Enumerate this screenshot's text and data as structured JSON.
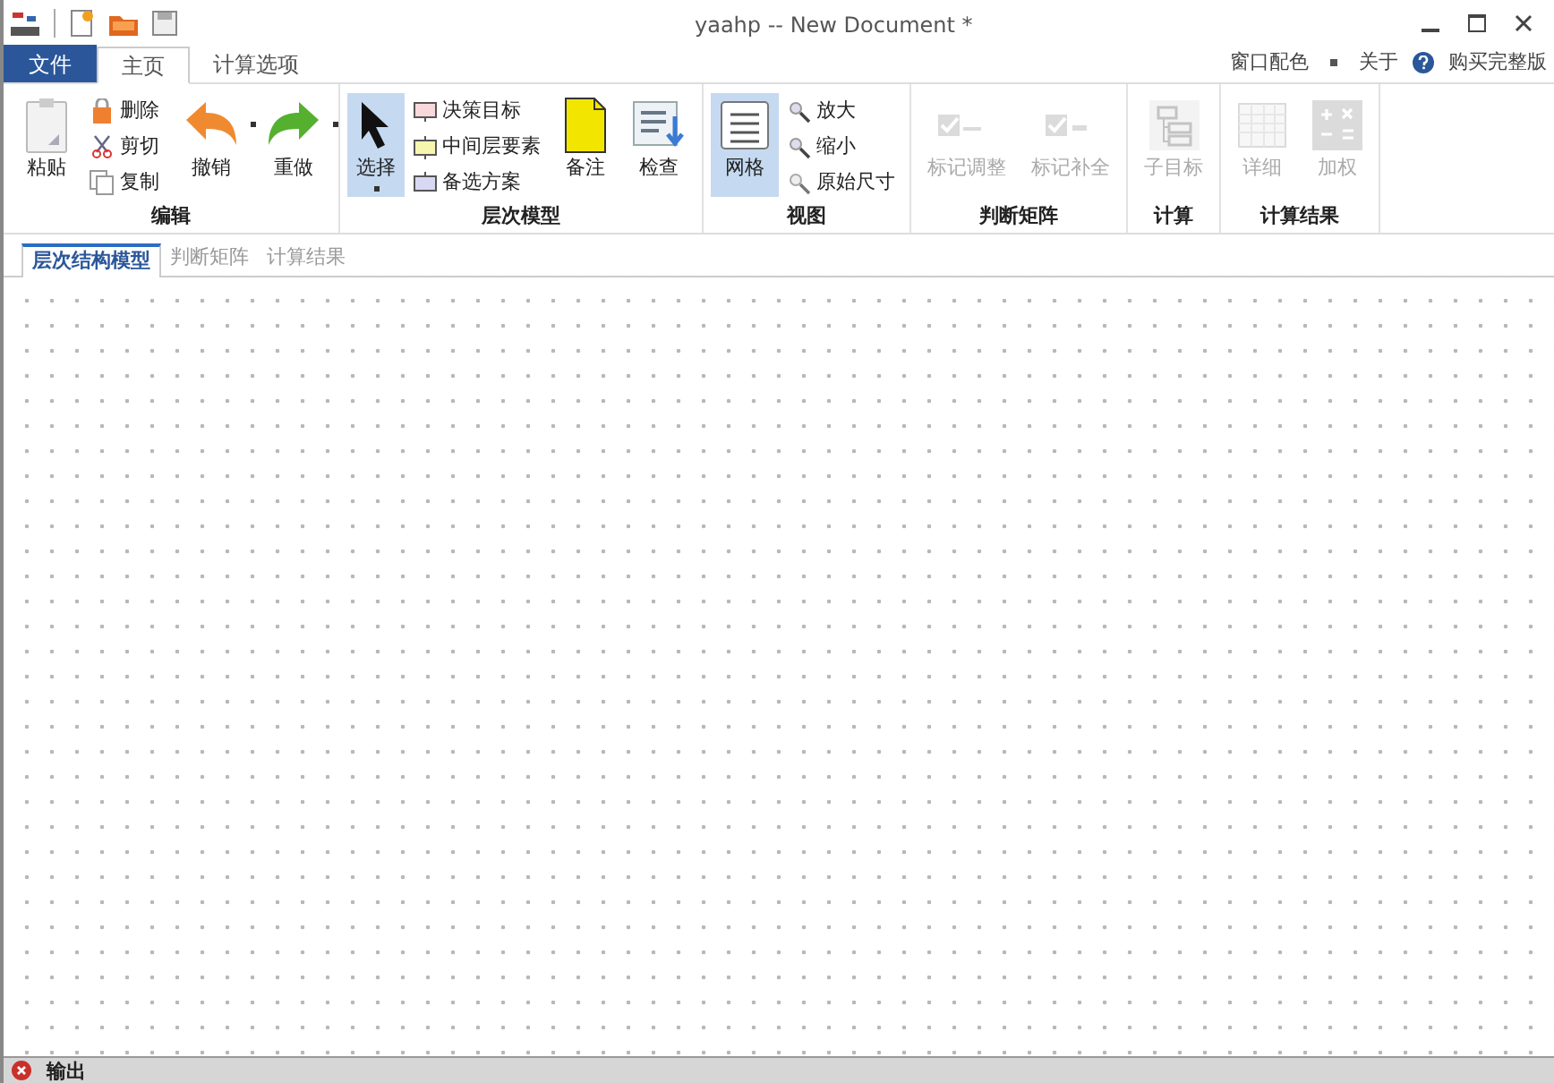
{
  "window": {
    "title": "yaahp -- New Document *"
  },
  "menu_tabs": [
    {
      "label": "文件",
      "kind": "file",
      "selected": false
    },
    {
      "label": "主页",
      "kind": "tab",
      "selected": true
    },
    {
      "label": "计算选项",
      "kind": "tab",
      "selected": false
    }
  ],
  "right_links": [
    {
      "label": "窗口配色",
      "kind": "dropdown"
    },
    {
      "label": "关于",
      "kind": "link"
    },
    {
      "label": "购买完整版",
      "kind": "help"
    }
  ],
  "ribbon_groups": [
    {
      "label": "编辑",
      "items": [
        {
          "kind": "large",
          "label": "粘贴",
          "selected": false,
          "disabled": false,
          "dropdown": false
        },
        {
          "kind": "stack",
          "items": [
            {
              "label": "删除"
            },
            {
              "label": "剪切"
            },
            {
              "label": "复制"
            }
          ]
        },
        {
          "kind": "large",
          "label": "撤销",
          "selected": false,
          "disabled": false,
          "dropdown": true
        },
        {
          "kind": "large",
          "label": "重做",
          "selected": false,
          "disabled": false,
          "dropdown": true
        }
      ]
    },
    {
      "label": "层次模型",
      "items": [
        {
          "kind": "large",
          "label": "选择",
          "selected": true,
          "disabled": false,
          "dropdown": true
        },
        {
          "kind": "stack",
          "items": [
            {
              "label": "决策目标"
            },
            {
              "label": "中间层要素"
            },
            {
              "label": "备选方案"
            }
          ]
        },
        {
          "kind": "large",
          "label": "备注",
          "selected": false,
          "disabled": false,
          "dropdown": false
        },
        {
          "kind": "large",
          "label": "检查",
          "selected": false,
          "disabled": false,
          "dropdown": false
        }
      ]
    },
    {
      "label": "视图",
      "items": [
        {
          "kind": "large",
          "label": "网格",
          "selected": true,
          "disabled": false,
          "dropdown": false
        },
        {
          "kind": "stack",
          "items": [
            {
              "label": "放大"
            },
            {
              "label": "缩小"
            },
            {
              "label": "原始尺寸"
            }
          ]
        }
      ]
    },
    {
      "label": "判断矩阵",
      "items": [
        {
          "kind": "large",
          "label": "标记调整",
          "selected": false,
          "disabled": true,
          "dropdown": false
        },
        {
          "kind": "large",
          "label": "标记补全",
          "selected": false,
          "disabled": true,
          "dropdown": false
        }
      ]
    },
    {
      "label": "计算",
      "items": [
        {
          "kind": "large",
          "label": "子目标",
          "selected": false,
          "disabled": true,
          "dropdown": false
        }
      ]
    },
    {
      "label": "计算结果",
      "items": [
        {
          "kind": "large",
          "label": "详细",
          "selected": false,
          "disabled": true,
          "dropdown": false
        },
        {
          "kind": "large",
          "label": "加权",
          "selected": false,
          "disabled": true,
          "dropdown": false
        }
      ]
    }
  ],
  "document_tabs": [
    {
      "label": "层次结构模型",
      "selected": true
    },
    {
      "label": "判断矩阵",
      "selected": false
    },
    {
      "label": "计算结果",
      "selected": false
    }
  ],
  "output_panel": {
    "title": "输出"
  }
}
